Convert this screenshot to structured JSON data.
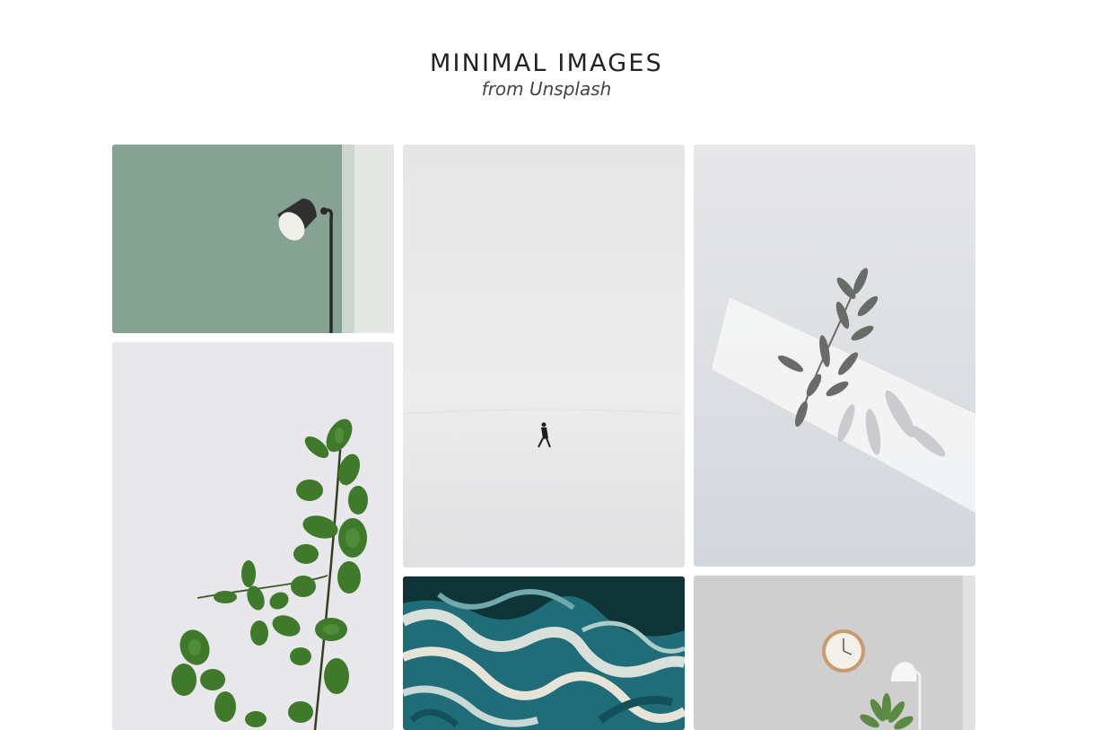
{
  "header": {
    "title": "MINIMAL IMAGES",
    "subtitle": "from Unsplash"
  },
  "gallery": {
    "images": [
      {
        "subject": "black floor lamp against sage green wall"
      },
      {
        "subject": "lone person walking across a white snowy expanse"
      },
      {
        "subject": "dried olive sprig with shadows on white"
      },
      {
        "subject": "green eucalyptus branch on pale grey"
      },
      {
        "subject": "teal and cream marbled fluid swirls"
      },
      {
        "subject": "wooden wall clock, white lamp and plant on grey wall"
      }
    ]
  },
  "colors": {
    "background": "#ffffff",
    "title": "#222222",
    "subtitle": "#444444"
  }
}
